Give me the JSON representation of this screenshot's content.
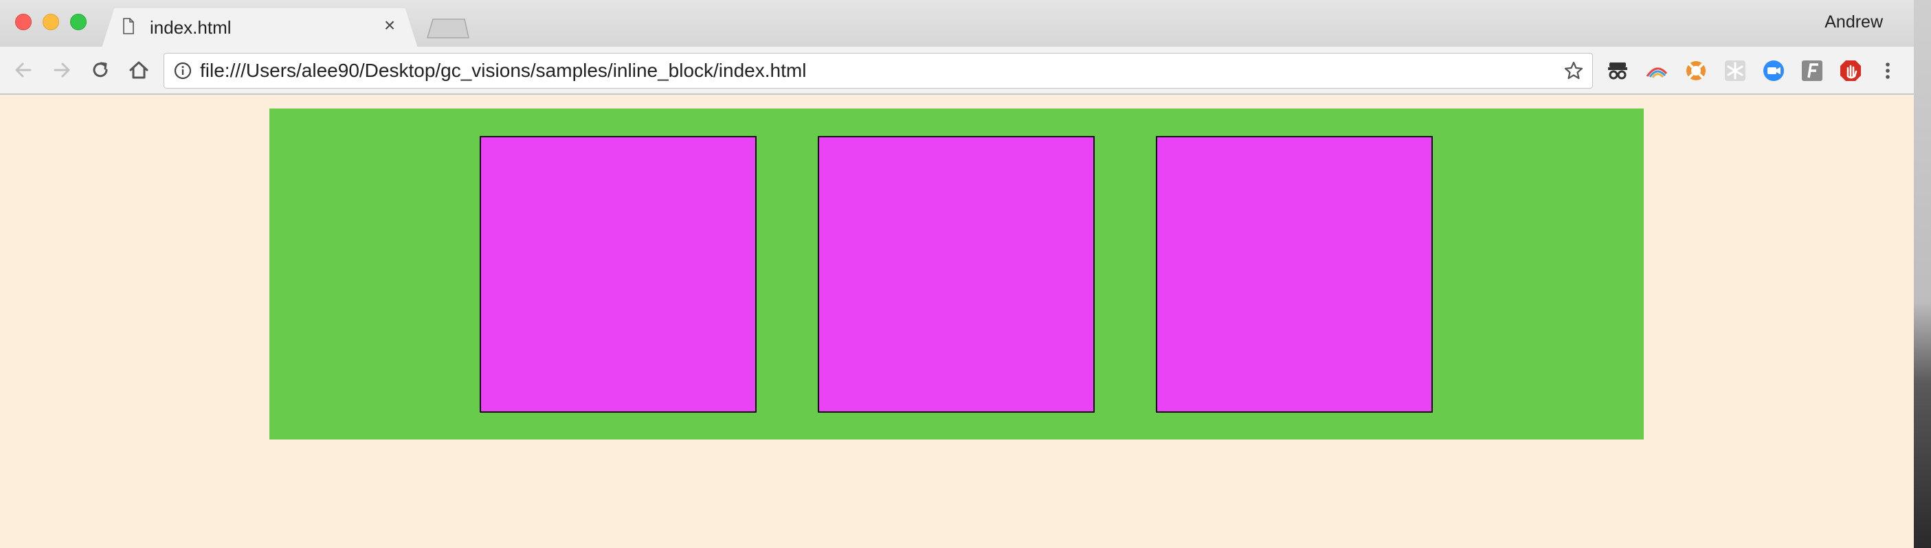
{
  "browser": {
    "tab_title": "index.html",
    "tab_close_glyph": "×",
    "profile_name": "Andrew",
    "url": "file:///Users/alee90/Desktop/gc_visions/samples/inline_block/index.html"
  },
  "icons": {
    "back": "arrow-left-icon",
    "forward": "arrow-right-icon",
    "reload": "reload-icon",
    "home": "home-icon",
    "info": "info-icon",
    "bookmark": "star-icon",
    "menu": "kebab-menu-icon"
  },
  "extensions": [
    "incognito-mask-icon",
    "rainbow-arc-icon",
    "lifebuoy-icon",
    "snowflake-icon",
    "video-camera-icon",
    "f-logo-icon",
    "stop-hand-icon"
  ],
  "colors": {
    "page_background": "#fdeedb",
    "container_background": "#69cb4c",
    "box_fill": "#ea42f5",
    "box_border": "#111111"
  },
  "content": {
    "box_count": 3
  }
}
